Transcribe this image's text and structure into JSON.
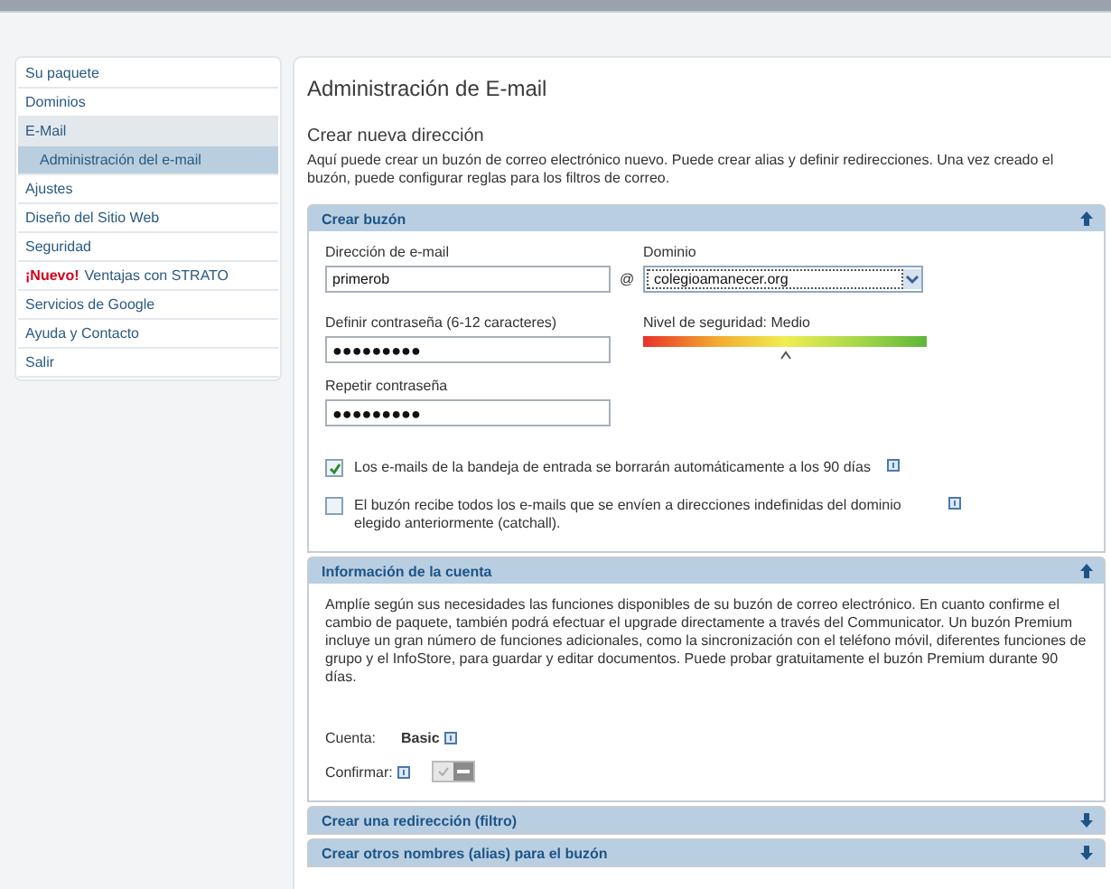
{
  "sidebar": {
    "items": [
      {
        "label": "Su paquete",
        "selected": false
      },
      {
        "label": "Dominios",
        "selected": false
      },
      {
        "label": "E-Mail",
        "selected": false,
        "expanded": true,
        "children": [
          {
            "label": "Administración del e-mail",
            "selected": true
          }
        ]
      },
      {
        "label": "Ajustes",
        "selected": false
      },
      {
        "label": "Diseño del Sitio Web",
        "selected": false
      },
      {
        "label": "Seguridad",
        "selected": false
      },
      {
        "badge": "¡Nuevo!",
        "label": "Ventajas con STRATO",
        "selected": false
      },
      {
        "label": "Servicios de Google",
        "selected": false
      },
      {
        "label": "Ayuda y Contacto",
        "selected": false
      },
      {
        "label": "Salir",
        "selected": false
      }
    ]
  },
  "page": {
    "title": "Administración de E-mail",
    "subtitle": "Crear nueva dirección",
    "description": "Aquí puede crear un buzón de correo electrónico nuevo. Puede crear alias y definir redirecciones. Una vez creado el buzón, puede configurar reglas para los filtros de correo."
  },
  "sections": [
    {
      "kind": "mailbox",
      "title": "Crear buzón",
      "expanded": true,
      "email": {
        "label": "Dirección de e-mail",
        "value": "primerob"
      },
      "at": "@",
      "domain": {
        "label": "Dominio",
        "value": "colegioamanecer.org"
      },
      "password": {
        "label": "Definir contraseña (6-12 caracteres)",
        "value": "●●●●●●●●●"
      },
      "security": {
        "label": "Nivel de seguridad: Medio",
        "level": 0.5
      },
      "repeat": {
        "label": "Repetir contraseña",
        "value": "●●●●●●●●●"
      },
      "options": [
        {
          "label": "Los e-mails de la bandeja de entrada se borrarán automáticamente a los 90 días",
          "checked": true
        },
        {
          "label": "El buzón recibe todos los e-mails que se envíen a direcciones indefinidas del dominio elegido anteriormente (catchall).",
          "checked": false
        }
      ]
    },
    {
      "kind": "account",
      "title": "Información de la cuenta",
      "expanded": true,
      "text": "Amplíe según sus necesidades las funciones disponibles de su buzón de correo electrónico. En cuanto confirme el cambio de paquete, también podrá efectuar el upgrade directamente a través del Communicator. Un buzón Premium incluye un gran número de funciones adicionales, como la sincronización con el teléfono móvil, diferentes funciones de grupo y el InfoStore, para guardar y editar documentos. Puede probar gratuitamente el buzón Premium durante 90 días.",
      "account_label": "Cuenta:",
      "account_value": "Basic",
      "confirm_label": "Confirmar:",
      "confirm_on": false
    },
    {
      "title": "Crear una redirección (filtro)",
      "expanded": false
    },
    {
      "title": "Crear otros nombres (alias) para el buzón",
      "expanded": false
    }
  ]
}
